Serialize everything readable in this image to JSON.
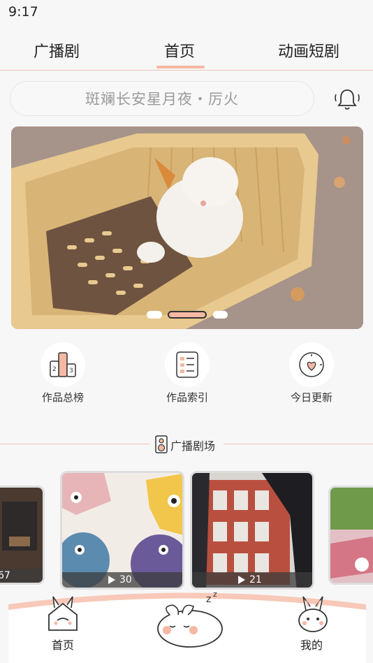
{
  "status_bar": {
    "time": "9:17"
  },
  "top_tabs": [
    {
      "label": "广播剧"
    },
    {
      "label": "首页"
    },
    {
      "label": "动画短剧"
    }
  ],
  "search": {
    "placeholder": "斑斓长安星月夜・厉火"
  },
  "banner": {
    "active_index": 1,
    "count": 3
  },
  "quick_links": [
    {
      "label": "作品总榜",
      "icon": "ranking-podium-icon"
    },
    {
      "label": "作品索引",
      "icon": "index-list-icon"
    },
    {
      "label": "今日更新",
      "icon": "clock-heart-icon"
    }
  ],
  "section": {
    "title": "广播剧场",
    "icon": "speaker-icon"
  },
  "cards": [
    {
      "play_count": "67"
    },
    {
      "play_count": "30"
    },
    {
      "play_count": "21"
    },
    {
      "play_count": ""
    }
  ],
  "bottom_nav": [
    {
      "label": "首页",
      "icon": "bunny-house-icon"
    },
    {
      "label": "",
      "icon": "sleeping-bunny-icon"
    },
    {
      "label": "我的",
      "icon": "bunny-face-icon"
    }
  ],
  "colors": {
    "accent": "#f4b8a4",
    "divider": "#f0c3b3",
    "background": "#f7f7f7"
  }
}
